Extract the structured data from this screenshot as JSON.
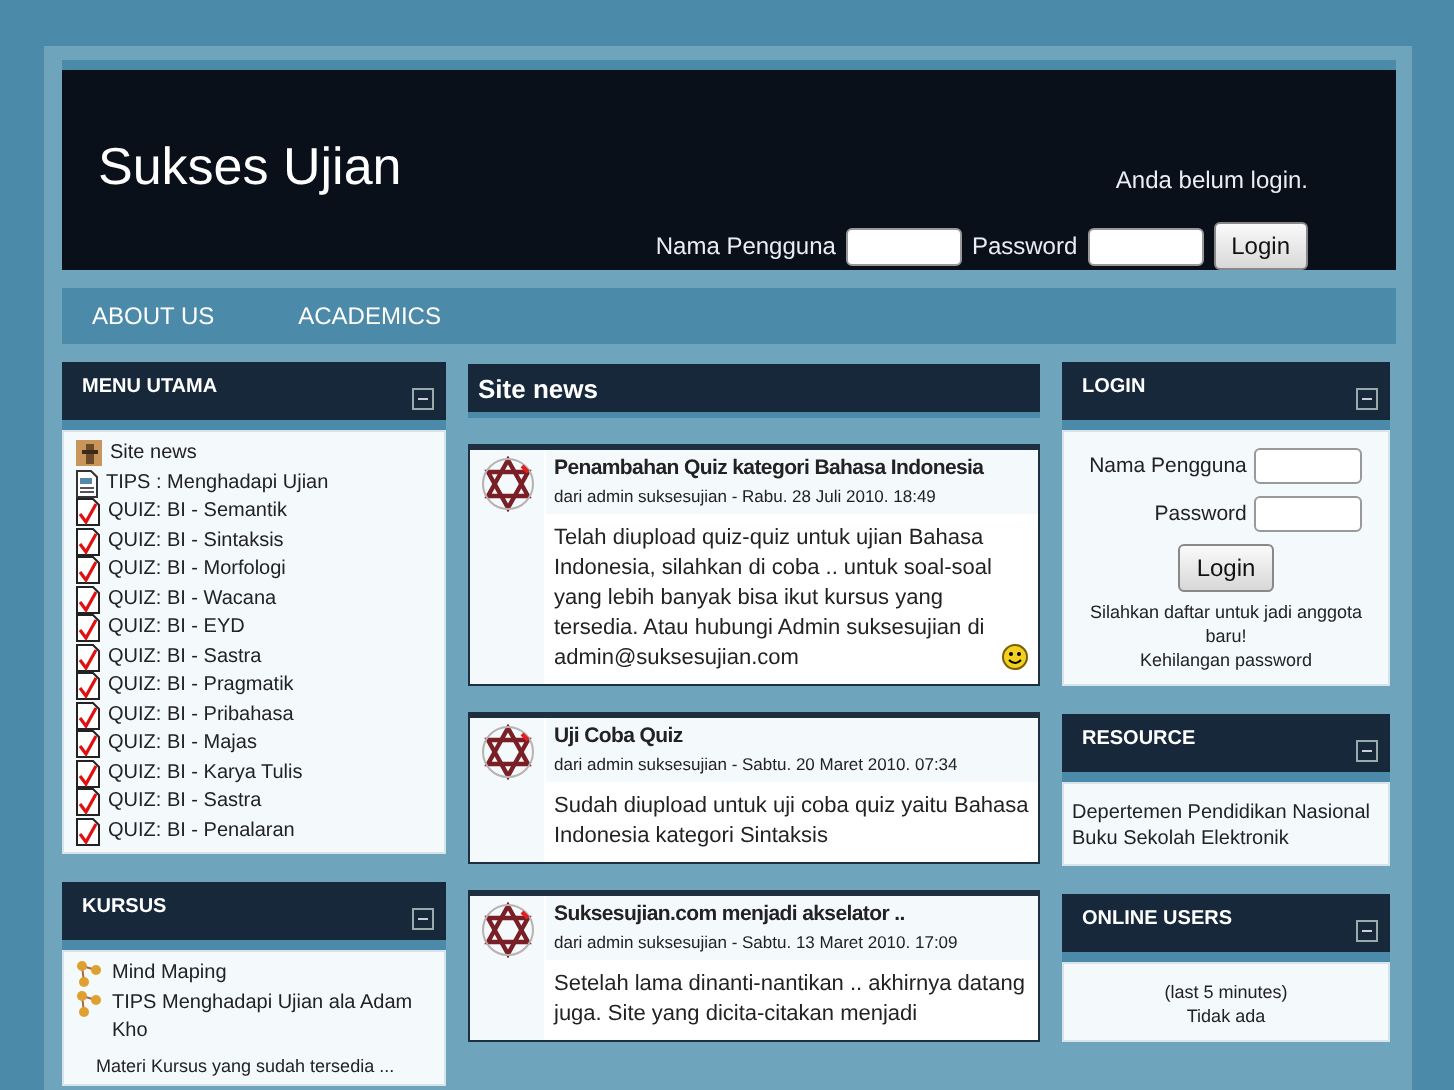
{
  "site": {
    "title": "Sukses Ujian",
    "login_status": "Anda belum login.",
    "login_form": {
      "username_label": "Nama Pengguna",
      "password_label": "Password",
      "button": "Login"
    }
  },
  "nav": {
    "items": [
      "ABOUT US",
      "ACADEMICS"
    ]
  },
  "left_blocks": [
    {
      "title": "MENU UTAMA",
      "items": [
        {
          "kind": "news",
          "label": "Site news"
        },
        {
          "kind": "page",
          "label": "TIPS : Menghadapi Ujian"
        },
        {
          "kind": "quiz",
          "label": "QUIZ: BI - Semantik"
        },
        {
          "kind": "quiz",
          "label": "QUIZ: BI - Sintaksis"
        },
        {
          "kind": "quiz",
          "label": "QUIZ: BI - Morfologi"
        },
        {
          "kind": "quiz",
          "label": "QUIZ: BI - Wacana"
        },
        {
          "kind": "quiz",
          "label": "QUIZ: BI - EYD"
        },
        {
          "kind": "quiz",
          "label": "QUIZ: BI - Sastra"
        },
        {
          "kind": "quiz",
          "label": "QUIZ: BI - Pragmatik"
        },
        {
          "kind": "quiz",
          "label": "QUIZ: BI - Pribahasa"
        },
        {
          "kind": "quiz",
          "label": "QUIZ: BI - Majas"
        },
        {
          "kind": "quiz",
          "label": "QUIZ: BI - Karya Tulis"
        },
        {
          "kind": "quiz",
          "label": "QUIZ: BI - Sastra"
        },
        {
          "kind": "quiz",
          "label": "QUIZ: BI - Penalaran"
        }
      ]
    },
    {
      "title": "KURSUS",
      "items": [
        {
          "kind": "course",
          "label": "Mind Maping"
        },
        {
          "kind": "course",
          "label": "TIPS Menghadapi Ujian ala Adam Kho"
        }
      ],
      "footer": "Materi Kursus yang sudah tersedia ..."
    }
  ],
  "site_news": {
    "title": "Site news",
    "posts": [
      {
        "title": "Penambahan Quiz kategori Bahasa Indonesia",
        "meta": "dari admin suksesujian - Rabu. 28 Juli 2010. 18:49",
        "body": "Telah diupload quiz-quiz untuk ujian Bahasa Indonesia, silahkan di coba .. untuk soal-soal yang lebih banyak bisa ikut kursus yang tersedia. Atau hubungi Admin suksesujian di admin@suksesujian.com",
        "smiley": true
      },
      {
        "title": "Uji Coba Quiz",
        "meta": "dari admin suksesujian - Sabtu. 20 Maret 2010. 07:34",
        "body": "Sudah diupload untuk uji coba quiz yaitu Bahasa Indonesia kategori Sintaksis",
        "smiley": false
      },
      {
        "title": "Suksesujian.com menjadi akselator ..",
        "meta": "dari admin suksesujian - Sabtu. 13 Maret 2010. 17:09",
        "body": "Setelah lama dinanti-nantikan .. akhirnya datang juga. Site yang dicita-citakan menjadi",
        "smiley": false
      }
    ]
  },
  "right_blocks": [
    {
      "kind": "login",
      "title": "LOGIN",
      "username_label": "Nama Pengguna",
      "password_label": "Password",
      "button": "Login",
      "signup": "Silahkan daftar untuk jadi anggota baru!",
      "forgot": "Kehilangan password"
    },
    {
      "kind": "links",
      "title": "RESOURCE",
      "lines": [
        "Depertemen Pendidikan Nasional",
        "Buku Sekolah Elektronik"
      ]
    },
    {
      "kind": "centered",
      "title": "ONLINE USERS",
      "lines": [
        "(last 5 minutes)",
        "Tidak ada"
      ]
    }
  ]
}
